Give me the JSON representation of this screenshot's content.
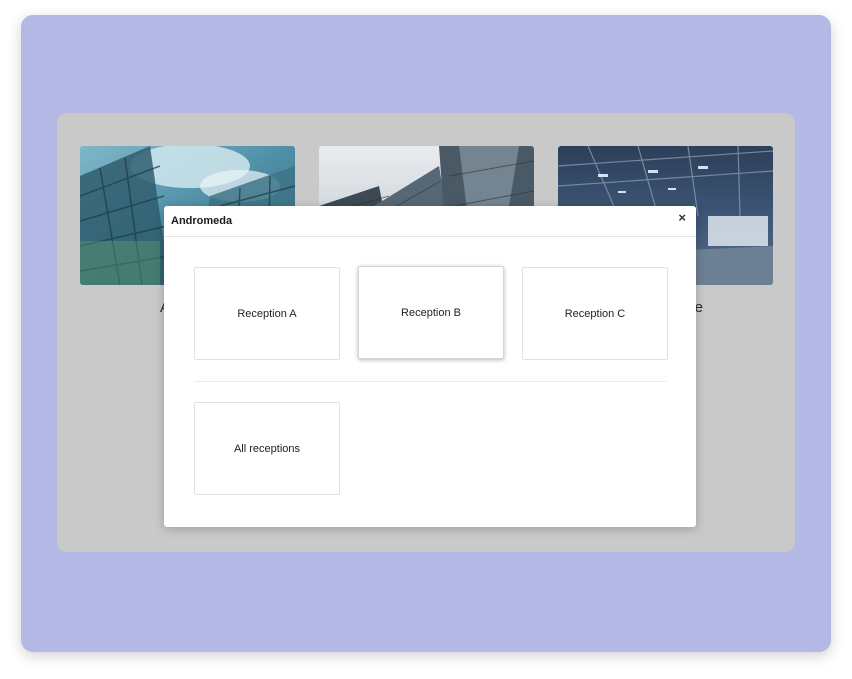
{
  "background": {
    "window_color": "#b3b8e5",
    "panel_color": "#c9c9c9"
  },
  "sites": [
    {
      "label": "America",
      "image": "glass-tower-sky-photo"
    },
    {
      "label": "",
      "image": "skyscrapers-perspective-photo"
    },
    {
      "label": "tre",
      "image": "warehouse-interior-photo"
    }
  ],
  "dialog": {
    "title": "Andromeda",
    "close_label": "×",
    "receptions": [
      {
        "label": "Reception A",
        "selected": false
      },
      {
        "label": "Reception B",
        "selected": true
      },
      {
        "label": "Reception C",
        "selected": false
      }
    ],
    "all_label": "All receptions"
  }
}
